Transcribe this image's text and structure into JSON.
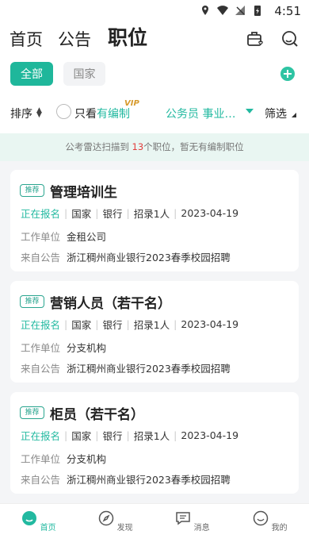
{
  "statusbar": {
    "time": "4:51"
  },
  "topnav": {
    "tabs": [
      "首页",
      "公告",
      "职位"
    ]
  },
  "filters": {
    "chips": [
      "全部",
      "国家"
    ]
  },
  "sortbar": {
    "sort": "排序",
    "only_prefix": "只看",
    "only_highlight": "有编制",
    "vip": "VIP",
    "category": "公务员 事业…",
    "filter": "筛选"
  },
  "banner": {
    "prefix": "公考雷达扫描到 ",
    "count": "13",
    "suffix": "个职位，暂无有编制职位"
  },
  "labels": {
    "badge": "推荐",
    "work_unit": "工作单位",
    "from_notice": "来自公告"
  },
  "jobs": [
    {
      "title": "管理培训生",
      "status": "正在报名",
      "region": "国家",
      "industry": "银行",
      "recruit": "招录1人",
      "date": "2023-04-19",
      "unit": "金租公司",
      "notice": "浙江稠州商业银行2023春季校园招聘"
    },
    {
      "title": "营销人员（若干名）",
      "status": "正在报名",
      "region": "国家",
      "industry": "银行",
      "recruit": "招录1人",
      "date": "2023-04-19",
      "unit": "分支机构",
      "notice": "浙江稠州商业银行2023春季校园招聘"
    },
    {
      "title": "柜员（若干名）",
      "status": "正在报名",
      "region": "国家",
      "industry": "银行",
      "recruit": "招录1人",
      "date": "2023-04-19",
      "unit": "分支机构",
      "notice": "浙江稠州商业银行2023春季校园招聘"
    }
  ],
  "bottomnav": {
    "items": [
      "首页",
      "发现",
      "消息",
      "我的"
    ],
    "active": "首页"
  },
  "colors": {
    "accent": "#22b9a0",
    "highlight_number": "#e23d3d",
    "vip": "#d79a2c"
  }
}
